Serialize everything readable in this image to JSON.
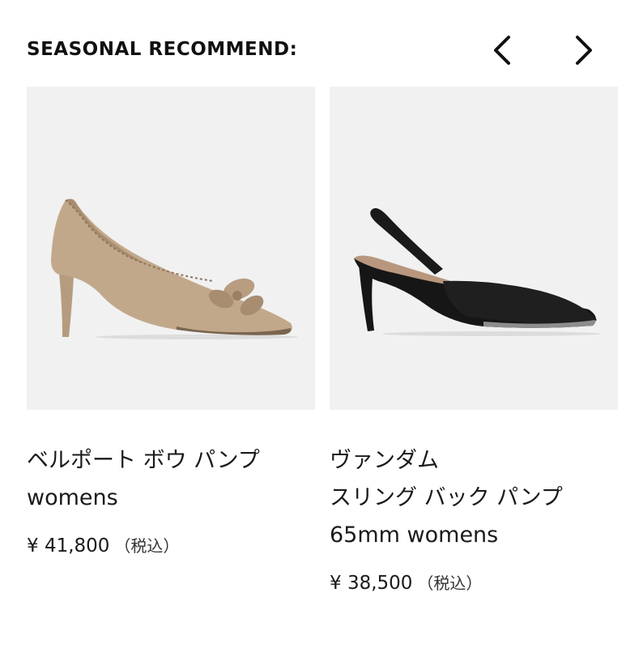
{
  "header": {
    "title": "SEASONAL RECOMMEND:",
    "prev_icon": "chevron-left-icon",
    "next_icon": "chevron-right-icon"
  },
  "products": [
    {
      "name_lines": [
        "ベルポート ボウ パンプ",
        "womens"
      ],
      "price": "¥ 41,800",
      "tax_note": "（税込）",
      "image": "beige-suede-bow-pump",
      "colors": {
        "shoe": "#c2a88b",
        "background": "#f1f1f1"
      }
    },
    {
      "name_lines": [
        "ヴァンダム",
        "スリング バック パンプ",
        "65mm womens"
      ],
      "price": "¥ 38,500",
      "tax_note": "（税込）",
      "image": "black-leather-slingback-pump",
      "colors": {
        "shoe": "#161616",
        "background": "#f1f1f1"
      }
    }
  ]
}
